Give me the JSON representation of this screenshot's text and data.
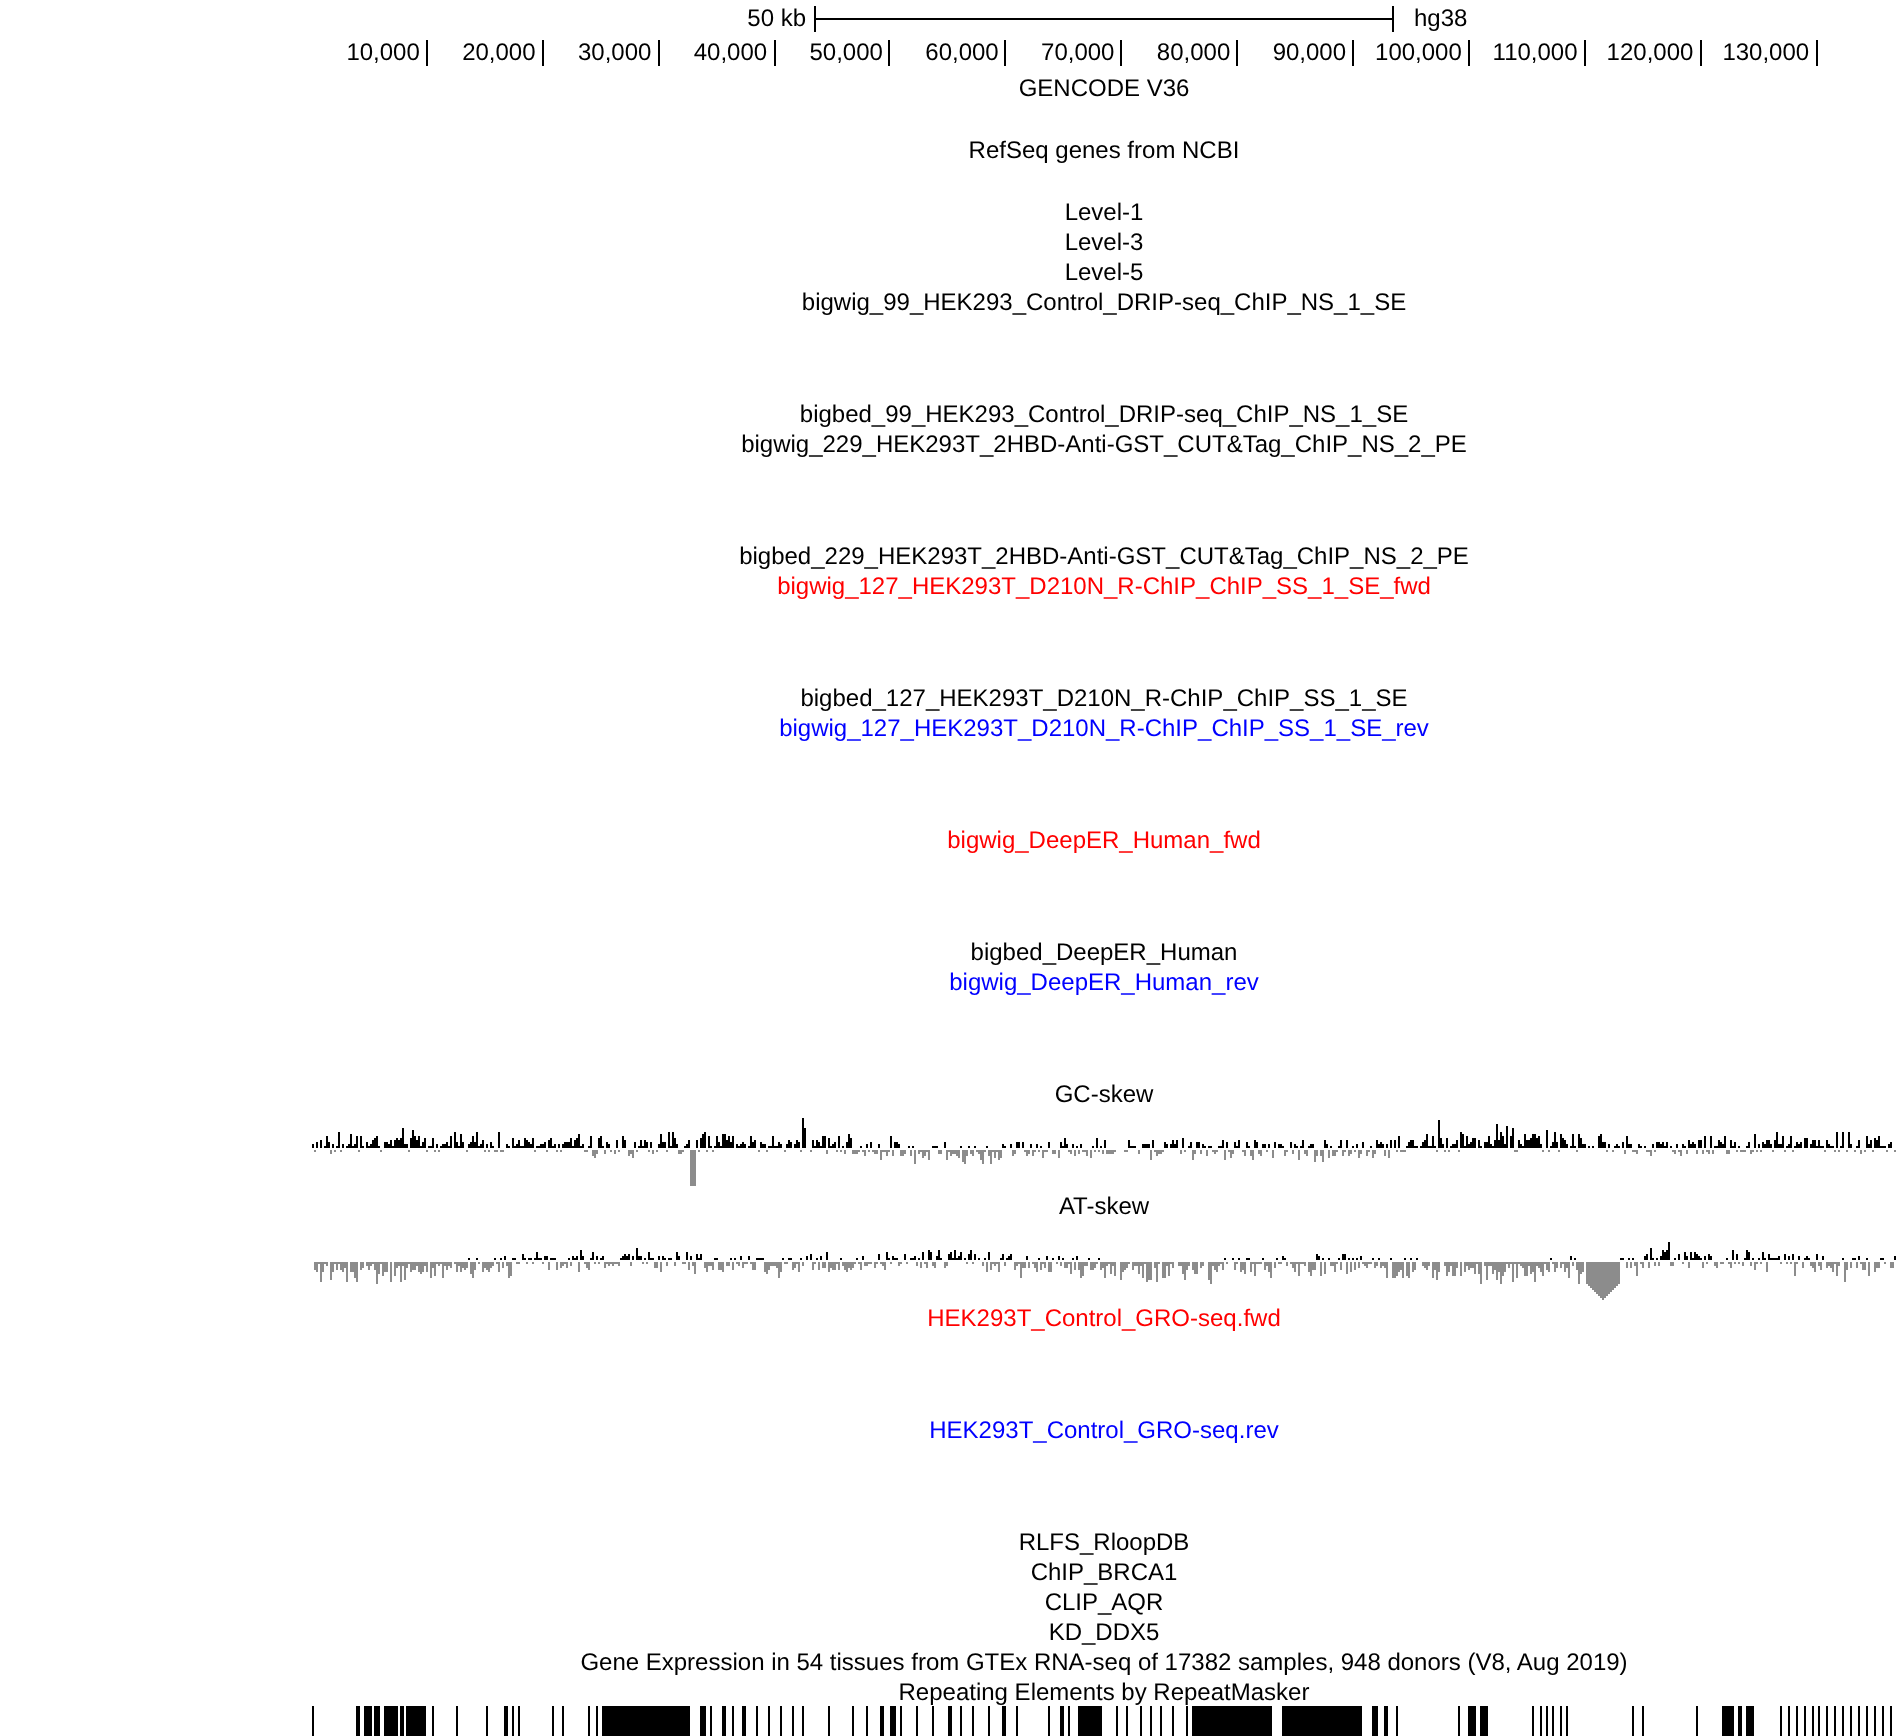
{
  "ruler": {
    "scale_label": "50 kb",
    "assembly": "hg38",
    "ticks": [
      "10,000",
      "20,000",
      "30,000",
      "40,000",
      "50,000",
      "60,000",
      "70,000",
      "80,000",
      "90,000",
      "100,000",
      "110,000",
      "120,000",
      "130,000"
    ]
  },
  "tracks": [
    {
      "label": "GENCODE V36",
      "color": "#000000",
      "kind": "gene"
    },
    {
      "label": "RefSeq genes from NCBI",
      "color": "#000000",
      "kind": "gene"
    },
    {
      "label": "Level-1",
      "color": "#000000",
      "kind": "bed"
    },
    {
      "label": "Level-3",
      "color": "#000000",
      "kind": "bed"
    },
    {
      "label": "Level-5",
      "color": "#000000",
      "kind": "bed"
    },
    {
      "label": "bigwig_99_HEK293_Control_DRIP-seq_ChIP_NS_1_SE",
      "color": "#000000",
      "kind": "wiggle"
    },
    {
      "label": "bigbed_99_HEK293_Control_DRIP-seq_ChIP_NS_1_SE",
      "color": "#000000",
      "kind": "bed"
    },
    {
      "label": "bigwig_229_HEK293T_2HBD-Anti-GST_CUT&Tag_ChIP_NS_2_PE",
      "color": "#000000",
      "kind": "wiggle"
    },
    {
      "label": "bigbed_229_HEK293T_2HBD-Anti-GST_CUT&Tag_ChIP_NS_2_PE",
      "color": "#000000",
      "kind": "bed"
    },
    {
      "label": "bigwig_127_HEK293T_D210N_R-ChIP_ChIP_SS_1_SE_fwd",
      "color": "#ff0000",
      "kind": "wiggle"
    },
    {
      "label": "bigbed_127_HEK293T_D210N_R-ChIP_ChIP_SS_1_SE",
      "color": "#000000",
      "kind": "bed"
    },
    {
      "label": "bigwig_127_HEK293T_D210N_R-ChIP_ChIP_SS_1_SE_rev",
      "color": "#0000ff",
      "kind": "wiggle"
    },
    {
      "label": "bigwig_DeepER_Human_fwd",
      "color": "#ff0000",
      "kind": "wiggle"
    },
    {
      "label": "bigbed_DeepER_Human",
      "color": "#000000",
      "kind": "bed"
    },
    {
      "label": "bigwig_DeepER_Human_rev",
      "color": "#0000ff",
      "kind": "wiggle"
    },
    {
      "label": "GC-skew",
      "color": "#000000",
      "kind": "skew"
    },
    {
      "label": "AT-skew",
      "color": "#000000",
      "kind": "skew"
    },
    {
      "label": "HEK293T_Control_GRO-seq.fwd",
      "color": "#ff0000",
      "kind": "wiggle"
    },
    {
      "label": "HEK293T_Control_GRO-seq.rev",
      "color": "#0000ff",
      "kind": "wiggle"
    },
    {
      "label": "RLFS_RloopDB",
      "color": "#000000",
      "kind": "bed"
    },
    {
      "label": "ChIP_BRCA1",
      "color": "#000000",
      "kind": "bed"
    },
    {
      "label": "CLIP_AQR",
      "color": "#000000",
      "kind": "bed"
    },
    {
      "label": "KD_DDX5",
      "color": "#000000",
      "kind": "bed"
    },
    {
      "label": "Gene Expression in 54 tissues from GTEx RNA-seq of 17382 samples, 948 donors (V8, Aug 2019)",
      "color": "#000000",
      "kind": "bed"
    },
    {
      "label": "Repeating Elements by RepeatMasker",
      "color": "#000000",
      "kind": "repeats"
    }
  ]
}
